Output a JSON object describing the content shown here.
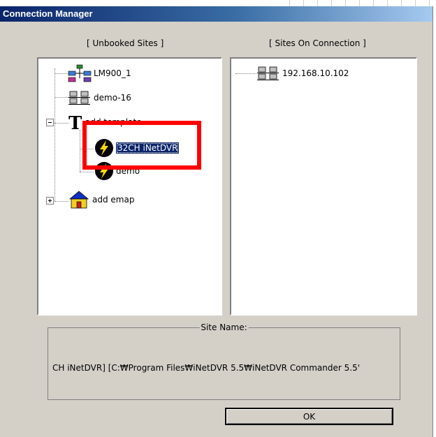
{
  "window": {
    "title": "Connection Manager"
  },
  "unbooked": {
    "caption": "[ Unbooked Sites ]",
    "items": [
      {
        "label": "LM900_1",
        "icon": "network-hub-icon"
      },
      {
        "label": "demo-16",
        "icon": "network-computers-icon"
      },
      {
        "label": "add template",
        "icon": "template-t-icon",
        "expanded": true,
        "children": [
          {
            "label": "32CH iNetDVR",
            "icon": "lightning-icon",
            "selected": true
          },
          {
            "label": "demo",
            "icon": "lightning-icon"
          }
        ]
      },
      {
        "label": "add emap",
        "icon": "house-icon",
        "expanded": false
      }
    ]
  },
  "connection": {
    "caption": "[ Sites On Connection ]",
    "items": [
      {
        "label": "192.168.10.102",
        "icon": "network-computers-icon"
      }
    ]
  },
  "site_name": {
    "legend": "Site Name:",
    "value": "CH iNetDVR] [C:₩Program Files₩iNetDVR 5.5₩iNetDVR Commander 5.5'"
  },
  "buttons": {
    "ok": "OK"
  },
  "colors": {
    "highlight": "#0a246a",
    "annotation": "#ff0000"
  }
}
